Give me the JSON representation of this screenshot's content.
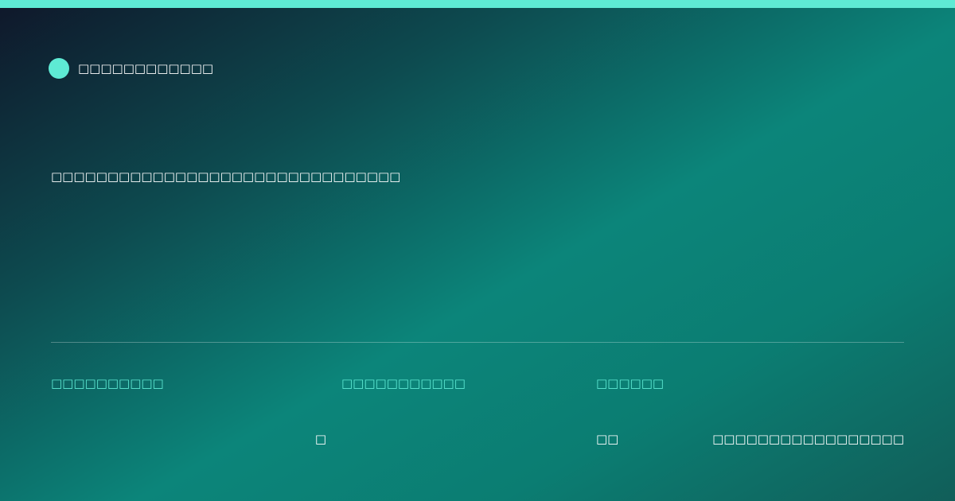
{
  "brand": {
    "name": "□□□□□□□□□□□□",
    "dot_color": "#5eead4"
  },
  "headline": "□□□□□□□□□□□□□□□□□□□□□□□□□□□□□□□",
  "meta": [
    {
      "label": "□□□□□□□□□□",
      "value": "□"
    },
    {
      "label": "□□□□□□□□□□□",
      "value": "□□"
    },
    {
      "label": "□□□□□□",
      "value": "□□□□□□□□□□□□□□□□□"
    }
  ],
  "colors": {
    "accent": "#5eead4",
    "gradient_dark": "#0f172a",
    "gradient_teal": "#0c857a"
  }
}
